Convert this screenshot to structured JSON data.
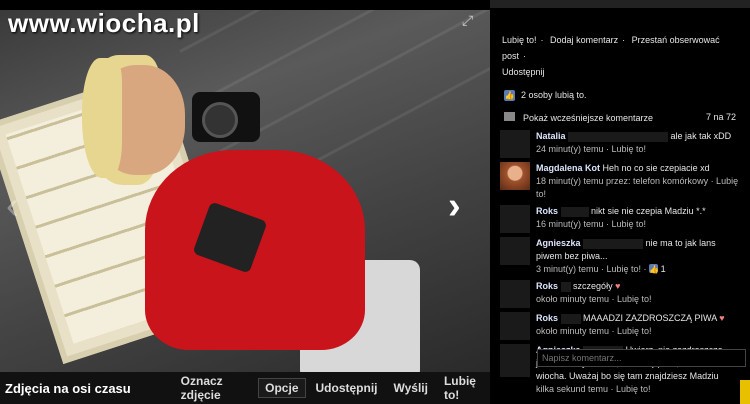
{
  "watermark": "www.wiocha.pl",
  "viewer": {
    "album_label": "Zdjęcia na osi czasu",
    "actions": [
      "Oznacz zdjęcie",
      "Opcje",
      "Udostępnij",
      "Wyślij",
      "Lubię to!"
    ],
    "nav_next": "›",
    "nav_prev": "‹"
  },
  "panel": {
    "action_links": [
      "Lubię to!",
      "Dodaj komentarz",
      "Przestań obserwować post",
      "Udostępnij"
    ],
    "separator": "·",
    "likes_text": "2 osoby lubią to.",
    "show_more": "Pokaż wcześniejsze komentarze",
    "count": "7 na 72",
    "comments": [
      {
        "name": "Natalia",
        "text": "ale jak tak xDD",
        "meta": "24 minut(y) temu · Lubię to!"
      },
      {
        "name": "Magdalena Kot",
        "text": "Heh no co sie czepiacie xd",
        "meta": "18 minut(y) temu przez: telefon komórkowy · Lubię to!"
      },
      {
        "name": "Roks",
        "text": "nikt sie nie czepia Madziu *.*",
        "meta": "16 minut(y) temu · Lubię to!"
      },
      {
        "name": "Agnieszka",
        "text": "nie ma to jak lans piwem bez piwa...",
        "meta": "3 minut(y) temu · Lubię to! · ",
        "like_count": "1"
      },
      {
        "name": "Roks",
        "text": "szczegóły",
        "meta": "około minuty temu · Lubię to!",
        "heart": "♥"
      },
      {
        "name": "Roks",
        "text": "MAAADZI ZAZDROSZCZĄ PIWA",
        "meta": "około minuty temu · Lubię to!",
        "heart": "♥"
      },
      {
        "name": "Agnieszka",
        "text": "Uwierz, nie zazdroszczę jestem abstynentem, nie lubię piwa, a ten \"lans\" to wiocha. Uważaj bo się tam znajdziesz Madziu",
        "meta": "kilka sekund temu · Lubię to!"
      }
    ],
    "comment_placeholder": "Napisz komentarz..."
  }
}
